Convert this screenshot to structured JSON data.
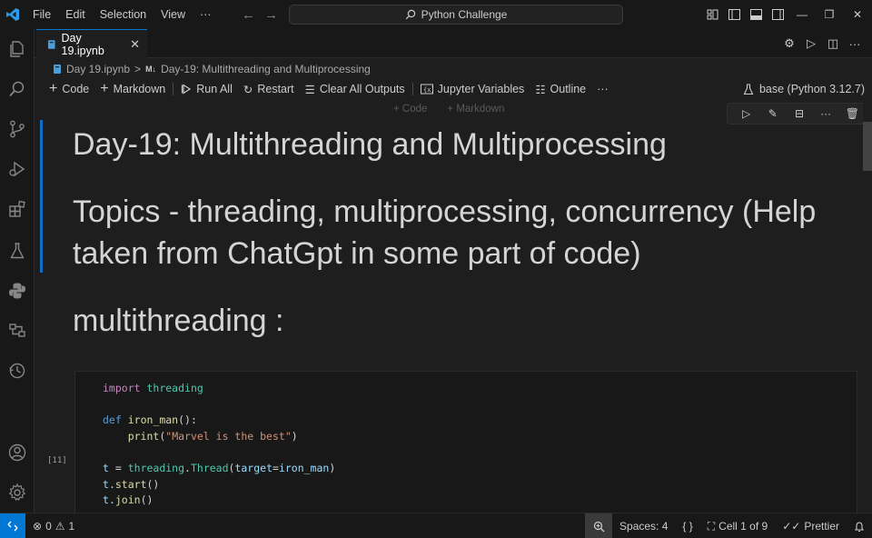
{
  "menu": [
    "File",
    "Edit",
    "Selection",
    "View",
    "···"
  ],
  "command_center": {
    "label": "Python Challenge",
    "icon": "search-icon"
  },
  "tab": {
    "label": "Day 19.ipynb",
    "icon": "notebook-icon"
  },
  "breadcrumb": {
    "file": "Day 19.ipynb",
    "separator": ">",
    "badge": "M↓",
    "heading": "Day-19: Multithreading and Multiprocessing"
  },
  "toolbar": {
    "code": "Code",
    "markdown": "Markdown",
    "run_all": "Run All",
    "restart": "Restart",
    "clear_outputs": "Clear All Outputs",
    "variables": "Jupyter Variables",
    "outline": "Outline",
    "more": "···",
    "kernel": "base (Python 3.12.7)"
  },
  "insert": {
    "code": "+ Code",
    "markdown": "+ Markdown"
  },
  "markdown_cell": {
    "h1": "Day-19: Multithreading and Multiprocessing",
    "h2": "Topics - threading, multiprocessing, concurrency (Help taken from ChatGpt in some part of code)",
    "h3": "multithreading :"
  },
  "code_cell": {
    "execution_count": "[11]"
  },
  "status": {
    "errors": "0",
    "warnings": "1",
    "spaces": "Spaces: 4",
    "braces": "{ }",
    "cell": "Cell 1 of 9",
    "formatter": "Prettier"
  },
  "colors": {
    "accent": "#0078d4",
    "keyword": "#c586c0",
    "function": "#dcdcaa",
    "string": "#ce9178"
  }
}
